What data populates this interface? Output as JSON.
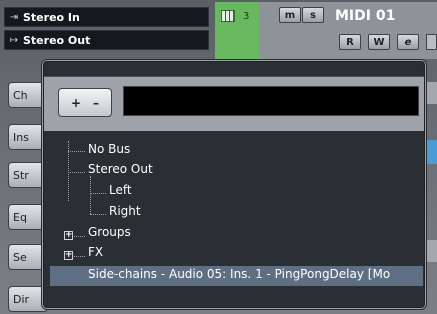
{
  "routing": {
    "input": {
      "icon": "input-arrow-icon",
      "glyph": "⇥",
      "label": "Stereo In"
    },
    "output": {
      "icon": "output-arrow-icon",
      "glyph": "↦",
      "label": "Stereo Out"
    }
  },
  "track": {
    "number": "3",
    "name": "MIDI 01",
    "mute": "m",
    "solo": "s",
    "read": "R",
    "write": "W",
    "edit": "e"
  },
  "side_buttons": [
    "Ch",
    "Ins",
    "Str",
    "Eq",
    "Se",
    "Dir"
  ],
  "popup": {
    "plus": "+",
    "minus": "–",
    "filter_value": "",
    "tree": [
      {
        "label": "No Bus"
      },
      {
        "label": "Stereo Out"
      },
      {
        "label": "Left"
      },
      {
        "label": "Right"
      },
      {
        "label": "Groups",
        "expander": "+"
      },
      {
        "label": "FX",
        "expander": "+"
      },
      {
        "label": "Side-chains - Audio 05: Ins. 1 - PingPongDelay [Mo",
        "selected": true
      }
    ]
  },
  "colors": {
    "track_green": "#67b85f",
    "selection": "#5e6f84"
  }
}
